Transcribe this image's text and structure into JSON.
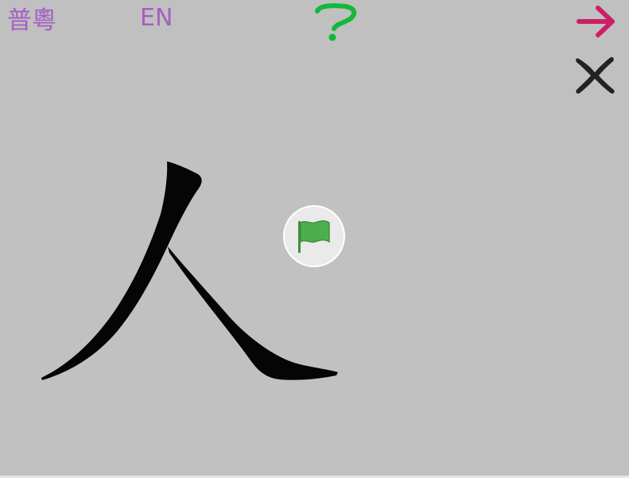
{
  "toolbar": {
    "lang_zh_label": "普粵",
    "lang_en_label": "EN",
    "help_icon": "question-mark-icon",
    "next_icon": "arrow-right-icon",
    "close_icon": "close-x-icon"
  },
  "canvas": {
    "character": "人",
    "flag_icon": "flag-icon"
  },
  "colors": {
    "background": "#c0c0c0",
    "lang": "#a45fc4",
    "help": "#12b83a",
    "next": "#cc1f67",
    "close": "#222222",
    "flag": "#4cae4c"
  }
}
